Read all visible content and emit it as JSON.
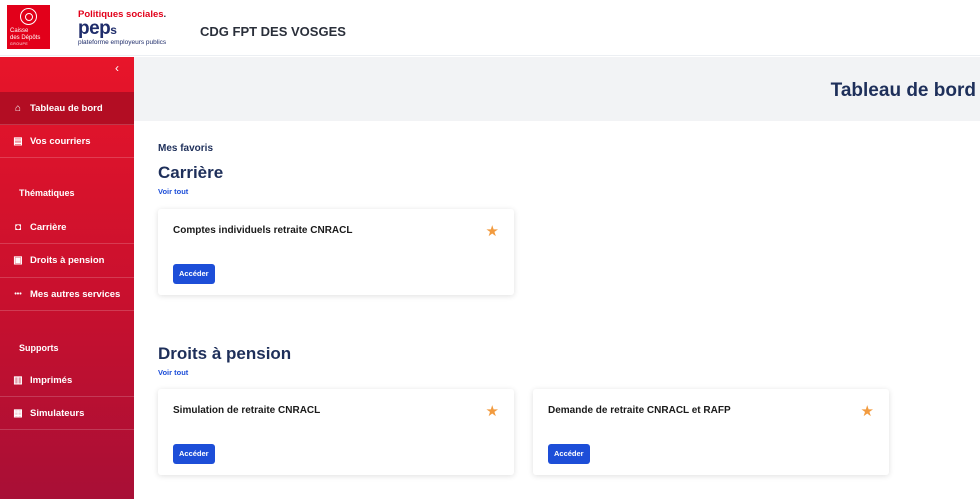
{
  "header": {
    "logo_lines": [
      "Caisse",
      "des Dépôts",
      "GROUPE"
    ],
    "brand_top": "Politiques sociales",
    "brand_dot": ".",
    "brand_name": "pep",
    "brand_name_s": "s",
    "brand_sub": "plateforme employeurs publics",
    "org_name": "CDG FPT DES VOSGES"
  },
  "sidebar": {
    "collapse_glyph": "‹",
    "items": [
      {
        "label": "Tableau de bord",
        "icon": "home-icon",
        "glyph": "⌂"
      },
      {
        "label": "Vos courriers",
        "icon": "document-icon",
        "glyph": "▤"
      },
      {
        "label": "Carrière",
        "icon": "briefcase-icon",
        "glyph": "◘"
      },
      {
        "label": "Droits à pension",
        "icon": "folder-icon",
        "glyph": "▣"
      },
      {
        "label": "Mes autres services",
        "icon": "more-icon",
        "glyph": "•••"
      },
      {
        "label": "Imprimés",
        "icon": "forms-icon",
        "glyph": "▥"
      },
      {
        "label": "Simulateurs",
        "icon": "calculator-icon",
        "glyph": "▦"
      }
    ],
    "sections": {
      "thematiques": "Thématiques",
      "supports": "Supports"
    }
  },
  "main": {
    "page_title": "Tableau de bord",
    "favorites_label": "Mes favoris",
    "sections": [
      {
        "title": "Carrière",
        "see_all": "Voir tout",
        "cards": [
          {
            "title": "Comptes individuels retraite CNRACL",
            "button": "Accéder",
            "star": "★"
          }
        ]
      },
      {
        "title": "Droits à pension",
        "see_all": "Voir tout",
        "cards": [
          {
            "title": "Simulation de retraite CNRACL",
            "button": "Accéder",
            "star": "★"
          },
          {
            "title": "Demande de retraite CNRACL et RAFP",
            "button": "Accéder",
            "star": "★"
          }
        ]
      }
    ]
  },
  "colors": {
    "brand_red": "#e2001a",
    "navy": "#1e2f5a",
    "button_blue": "#1d4ed8",
    "star_orange": "#f29b3f"
  }
}
